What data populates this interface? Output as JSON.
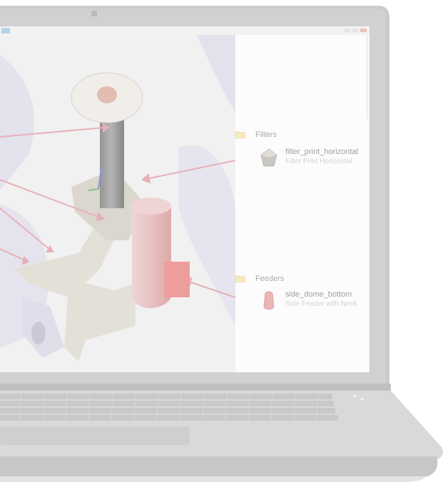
{
  "panel": {
    "groups": [
      {
        "label": "Filters",
        "items": [
          {
            "name": "filter_print_horizontal",
            "description": "Filter Print Horizontal"
          }
        ]
      },
      {
        "label": "Feeders",
        "items": [
          {
            "name": "side_dome_bottom",
            "description": "Side Feeder with Neck"
          }
        ]
      }
    ]
  },
  "colors": {
    "arrow": "#e0909c",
    "folder": "#f2e3a4",
    "laptop_body": "#c9c9c9",
    "screen_bezel": "#b3b3b3"
  },
  "icons": [
    "folder-icon",
    "filter-part-icon",
    "feeder-part-icon",
    "camera-icon"
  ]
}
